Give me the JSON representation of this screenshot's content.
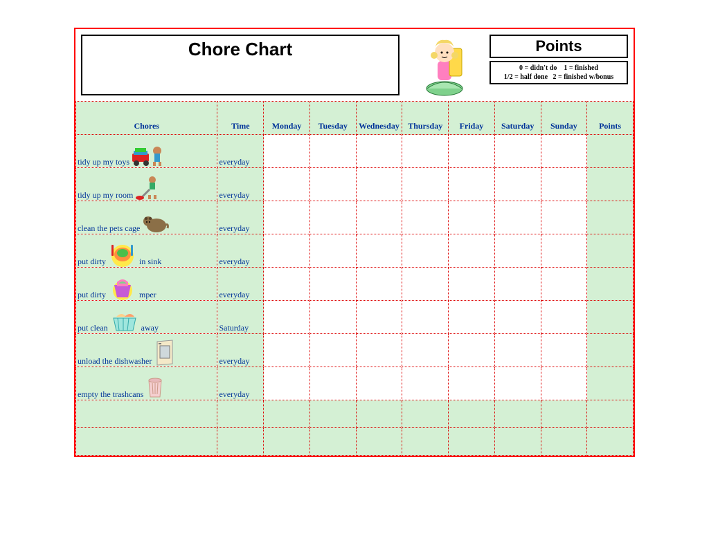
{
  "title": "Chore Chart",
  "points_title": "Points",
  "legend_line1": "0 = didn't do    1 = finished",
  "legend_line2": "1/2 = half done   2 = finished w/bonus",
  "headers": {
    "chores": "Chores",
    "time": "Time",
    "mon": "Monday",
    "tue": "Tuesday",
    "wed": "Wednesday",
    "thu": "Thursday",
    "fri": "Friday",
    "sat": "Saturday",
    "sun": "Sunday",
    "points": "Points"
  },
  "rows": [
    {
      "pre": "tidy up my toys",
      "post": "",
      "time": "everyday",
      "icon": "toys"
    },
    {
      "pre": "tidy up my room",
      "post": "",
      "time": "everyday",
      "icon": "vacuum"
    },
    {
      "pre": "clean the pets cage",
      "post": "",
      "time": "everyday",
      "icon": "pet"
    },
    {
      "pre": "put dirty",
      "post": "in sink",
      "time": "everyday",
      "icon": "dishes"
    },
    {
      "pre": "put dirty",
      "post": "mper",
      "time": "everyday",
      "icon": "hamper"
    },
    {
      "pre": "put clean",
      "post": "away",
      "time": "Saturday",
      "icon": "basket"
    },
    {
      "pre": "unload the dishwasher",
      "post": "",
      "time": "everyday",
      "icon": "dishwasher"
    },
    {
      "pre": "empty the trashcans",
      "post": "",
      "time": "everyday",
      "icon": "trashcan"
    }
  ]
}
